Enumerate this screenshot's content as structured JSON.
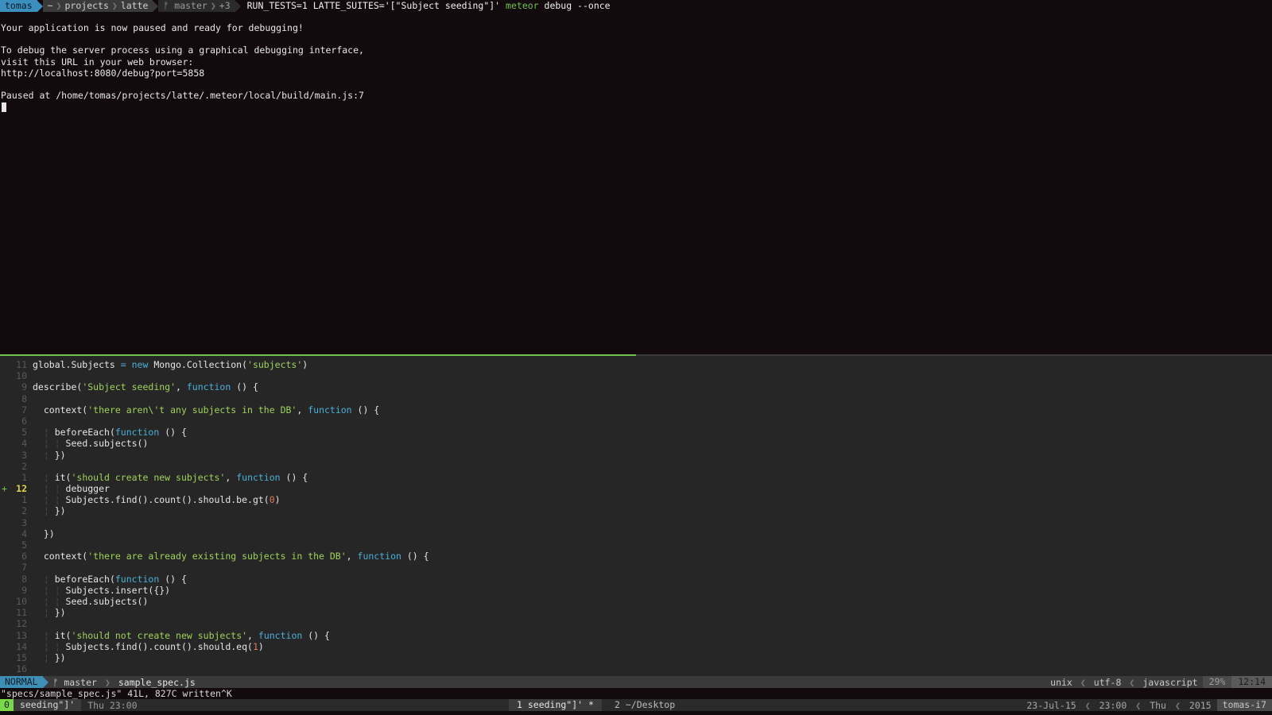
{
  "prompt": {
    "user": "tomas",
    "path": [
      "~",
      "projects",
      "latte"
    ],
    "branch": "master",
    "git_changes": "+3",
    "command_prefix": "RUN_TESTS=1 LATTE_SUITES='[\"Subject seeding\"]' ",
    "command_name": "meteor",
    "command_args": " debug --once"
  },
  "terminal_output": [
    "Your application is now paused and ready for debugging!",
    "",
    "To debug the server process using a graphical debugging interface,",
    "visit this URL in your web browser:",
    "http://localhost:8080/debug?port=5858",
    "",
    "Paused at /home/tomas/projects/latte/.meteor/local/build/main.js:7"
  ],
  "code_lines": [
    {
      "ln": "11",
      "parts": [
        [
          "c",
          "global.Subjects "
        ],
        [
          "k",
          "= new"
        ],
        [
          "c",
          " Mongo.Collection("
        ],
        [
          "s",
          "'subjects'"
        ],
        [
          "c",
          ")"
        ]
      ]
    },
    {
      "ln": "10",
      "parts": []
    },
    {
      "ln": "9",
      "parts": [
        [
          "c",
          "describe("
        ],
        [
          "s",
          "'Subject seeding'"
        ],
        [
          "c",
          ", "
        ],
        [
          "k",
          "function"
        ],
        [
          "c",
          " () {"
        ]
      ]
    },
    {
      "ln": "8",
      "parts": []
    },
    {
      "ln": "7",
      "parts": [
        [
          "c",
          "  context("
        ],
        [
          "s",
          "'there aren\\'t any subjects in the DB'"
        ],
        [
          "c",
          ", "
        ],
        [
          "k",
          "function"
        ],
        [
          "c",
          " () {"
        ]
      ]
    },
    {
      "ln": "6",
      "parts": []
    },
    {
      "ln": "5",
      "parts": [
        [
          "g",
          "  ¦ "
        ],
        [
          "c",
          "beforeEach("
        ],
        [
          "k",
          "function"
        ],
        [
          "c",
          " () {"
        ]
      ]
    },
    {
      "ln": "4",
      "parts": [
        [
          "g",
          "  ¦ ¦ "
        ],
        [
          "c",
          "Seed.subjects()"
        ]
      ]
    },
    {
      "ln": "3",
      "parts": [
        [
          "g",
          "  ¦ "
        ],
        [
          "c",
          "})"
        ]
      ]
    },
    {
      "ln": "2",
      "parts": []
    },
    {
      "ln": "1",
      "parts": [
        [
          "g",
          "  ¦ "
        ],
        [
          "c",
          "it("
        ],
        [
          "s",
          "'should create new subjects'"
        ],
        [
          "c",
          ", "
        ],
        [
          "k",
          "function"
        ],
        [
          "c",
          " () {"
        ]
      ]
    },
    {
      "ln": "12",
      "cur": true,
      "mark": "+",
      "parts": [
        [
          "g",
          "  ¦ ¦ "
        ],
        [
          "c",
          "debugger"
        ]
      ]
    },
    {
      "ln": "1",
      "parts": [
        [
          "g",
          "  ¦ ¦ "
        ],
        [
          "c",
          "Subjects.find().count().should.be.gt("
        ],
        [
          "n",
          "0"
        ],
        [
          "c",
          ")"
        ]
      ]
    },
    {
      "ln": "2",
      "parts": [
        [
          "g",
          "  ¦ "
        ],
        [
          "c",
          "})"
        ]
      ]
    },
    {
      "ln": "3",
      "parts": []
    },
    {
      "ln": "4",
      "parts": [
        [
          "c",
          "  })"
        ]
      ]
    },
    {
      "ln": "5",
      "parts": []
    },
    {
      "ln": "6",
      "parts": [
        [
          "c",
          "  context("
        ],
        [
          "s",
          "'there are already existing subjects in the DB'"
        ],
        [
          "c",
          ", "
        ],
        [
          "k",
          "function"
        ],
        [
          "c",
          " () {"
        ]
      ]
    },
    {
      "ln": "7",
      "parts": []
    },
    {
      "ln": "8",
      "parts": [
        [
          "g",
          "  ¦ "
        ],
        [
          "c",
          "beforeEach("
        ],
        [
          "k",
          "function"
        ],
        [
          "c",
          " () {"
        ]
      ]
    },
    {
      "ln": "9",
      "parts": [
        [
          "g",
          "  ¦ ¦ "
        ],
        [
          "c",
          "Subjects.insert({})"
        ]
      ]
    },
    {
      "ln": "10",
      "parts": [
        [
          "g",
          "  ¦ ¦ "
        ],
        [
          "c",
          "Seed.subjects()"
        ]
      ]
    },
    {
      "ln": "11",
      "parts": [
        [
          "g",
          "  ¦ "
        ],
        [
          "c",
          "})"
        ]
      ]
    },
    {
      "ln": "12",
      "parts": []
    },
    {
      "ln": "13",
      "parts": [
        [
          "g",
          "  ¦ "
        ],
        [
          "c",
          "it("
        ],
        [
          "s",
          "'should not create new subjects'"
        ],
        [
          "c",
          ", "
        ],
        [
          "k",
          "function"
        ],
        [
          "c",
          " () {"
        ]
      ]
    },
    {
      "ln": "14",
      "parts": [
        [
          "g",
          "  ¦ ¦ "
        ],
        [
          "c",
          "Subjects.find().count().should.eq("
        ],
        [
          "n",
          "1"
        ],
        [
          "c",
          ")"
        ]
      ]
    },
    {
      "ln": "15",
      "parts": [
        [
          "g",
          "  ¦ "
        ],
        [
          "c",
          "})"
        ]
      ]
    },
    {
      "ln": "16",
      "parts": []
    }
  ],
  "vim_status": {
    "mode": "NORMAL",
    "branch": "master",
    "file": "sample_spec.js",
    "fileformat": "unix",
    "encoding": "utf-8",
    "filetype": "javascript",
    "percent": "29%",
    "position": "12:14"
  },
  "vim_message": "\"specs/sample_spec.js\" 41L, 827C written^K",
  "tmux": {
    "window_index": "0",
    "session": "seeding\"]'",
    "time_left": "Thu 23:00",
    "window1": "1 seeding\"]' *",
    "window2": "2 ~/Desktop",
    "date": "23-Jul-15",
    "time": "23:00",
    "day": "Thu",
    "year": "2015",
    "host": "tomas-i7"
  },
  "colors": {
    "keyword": "#4ab0d8",
    "string": "#9fd35b",
    "number": "#e07a5f",
    "active_border": "#6fc24a",
    "mode_bg": "#3d8fb5"
  }
}
